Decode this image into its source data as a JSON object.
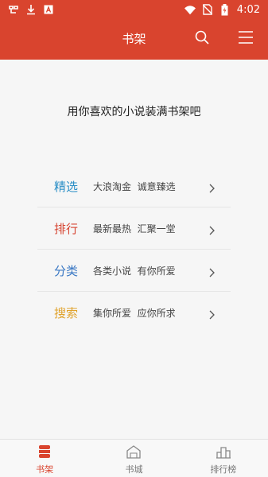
{
  "status_bar": {
    "time": "4:02",
    "left_icons": [
      "app-notification-icon",
      "download-icon",
      "app-a-icon"
    ],
    "right_icons": [
      "wifi-icon",
      "no-sim-icon",
      "battery-charging-icon"
    ]
  },
  "header": {
    "title": "书架",
    "search_icon": "search-icon",
    "menu_icon": "menu-icon",
    "background": "#d9442e"
  },
  "empty_message": "用你喜欢的小说装满书架吧",
  "menu": [
    {
      "title": "精选",
      "desc": "大浪淘金  诚意臻选",
      "color": "#2b8fc6"
    },
    {
      "title": "排行",
      "desc": "最新最热  汇聚一堂",
      "color": "#d64431"
    },
    {
      "title": "分类",
      "desc": "各类小说  有你所爱",
      "color": "#3a78c4"
    },
    {
      "title": "搜索",
      "desc": "集你所爱  应你所求",
      "color": "#e0a22b"
    }
  ],
  "tabs": [
    {
      "label": "书架",
      "icon": "bookshelf-icon",
      "active": true
    },
    {
      "label": "书城",
      "icon": "bookstore-icon",
      "active": false
    },
    {
      "label": "排行榜",
      "icon": "ranking-icon",
      "active": false
    }
  ]
}
